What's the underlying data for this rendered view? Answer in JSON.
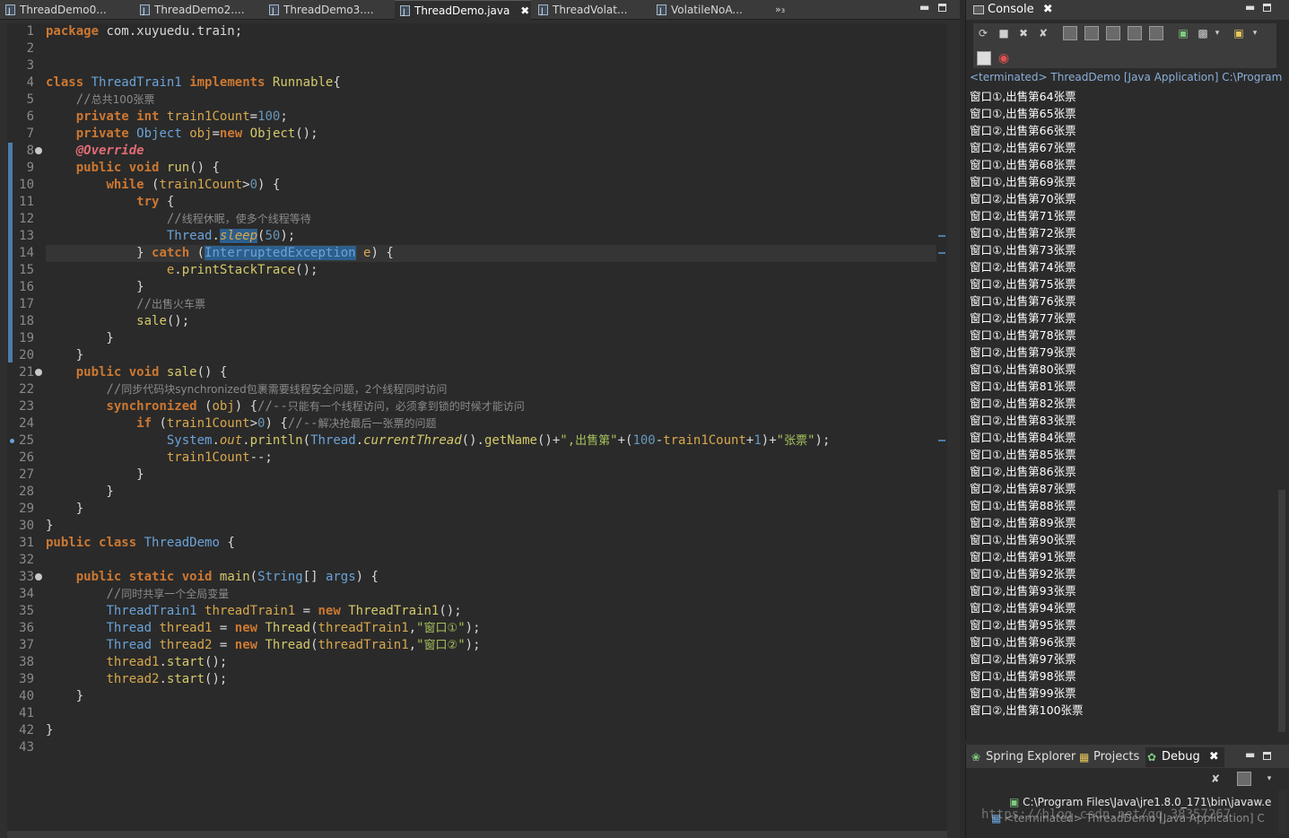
{
  "editor": {
    "tabs": [
      {
        "label": "ThreadDemo0...",
        "active": false
      },
      {
        "label": "ThreadDemo2....",
        "active": false
      },
      {
        "label": "ThreadDemo3....",
        "active": false
      },
      {
        "label": "ThreadDemo.java",
        "active": true
      },
      {
        "label": "ThreadVolat...",
        "active": false
      },
      {
        "label": "VolatileNoA...",
        "active": false
      }
    ],
    "overflow_label": "»₃",
    "close_glyph": "✖",
    "current_line": 14,
    "line_count": 43
  },
  "console": {
    "title": "Console",
    "status": "<terminated> ThreadDemo [Java Application] C:\\Program Fi",
    "output": [
      "窗口①,出售第64张票",
      "窗口①,出售第65张票",
      "窗口②,出售第66张票",
      "窗口②,出售第67张票",
      "窗口①,出售第68张票",
      "窗口①,出售第69张票",
      "窗口②,出售第70张票",
      "窗口②,出售第71张票",
      "窗口①,出售第72张票",
      "窗口①,出售第73张票",
      "窗口②,出售第74张票",
      "窗口②,出售第75张票",
      "窗口①,出售第76张票",
      "窗口②,出售第77张票",
      "窗口①,出售第78张票",
      "窗口②,出售第79张票",
      "窗口①,出售第80张票",
      "窗口①,出售第81张票",
      "窗口②,出售第82张票",
      "窗口②,出售第83张票",
      "窗口①,出售第84张票",
      "窗口①,出售第85张票",
      "窗口②,出售第86张票",
      "窗口②,出售第87张票",
      "窗口①,出售第88张票",
      "窗口②,出售第89张票",
      "窗口①,出售第90张票",
      "窗口②,出售第91张票",
      "窗口①,出售第92张票",
      "窗口②,出售第93张票",
      "窗口②,出售第94张票",
      "窗口②,出售第95张票",
      "窗口①,出售第96张票",
      "窗口②,出售第97张票",
      "窗口①,出售第98张票",
      "窗口①,出售第99张票",
      "窗口②,出售第100张票"
    ]
  },
  "debug": {
    "tabs": [
      {
        "label": "Spring Explorer",
        "icon": "spring-leaf-icon",
        "active": false
      },
      {
        "label": "Projects",
        "icon": "projects-folder-icon",
        "active": false
      },
      {
        "label": "Debug",
        "icon": "debug-bug-icon",
        "active": true
      }
    ],
    "tree_line_1": "C:\\Program Files\\Java\\jre1.8.0_171\\bin\\javaw.e",
    "tree_line_2": "<terminated> ThreadDemo [Java Application] C",
    "watermark": "https://blog.csdn.net/qq_38357267"
  },
  "colors": {
    "keyword": "#cc7832",
    "type": "#6aa3d8",
    "comment": "#8a8a8a",
    "string": "#a5c25c",
    "number": "#6897bb",
    "annotation": "#e06c75",
    "console_text": "#ffffff",
    "status_text": "#8aaed8"
  }
}
